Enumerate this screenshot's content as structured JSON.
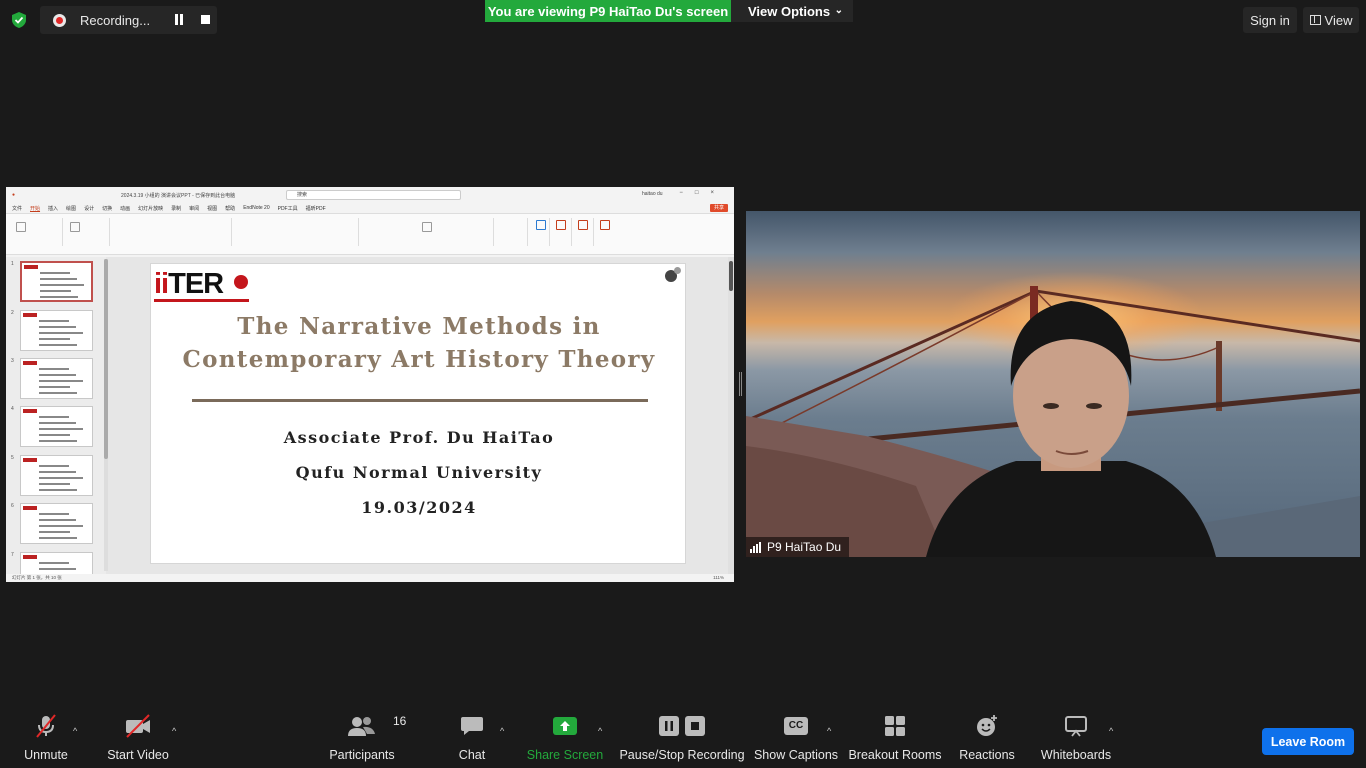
{
  "top_bar": {
    "security_icon": "shield-check-icon",
    "recording_label": "Recording...",
    "viewing_banner": "You are viewing P9 HaiTao Du's screen",
    "view_options_label": "View Options",
    "sign_in_label": "Sign in",
    "view_label": "View"
  },
  "shared_screen": {
    "ppt_title_bar": "2024.3.19 小组的 演讲会议PPT - 已保存到此台电脑",
    "search_placeholder": "搜索",
    "user_name": "haitao du",
    "menu_items": [
      "文件",
      "开始",
      "插入",
      "绘图",
      "设计",
      "切换",
      "动画",
      "幻灯片放映",
      "录制",
      "审阅",
      "视图",
      "帮助",
      "EndNote 20",
      "PDF工具",
      "福昕PDF"
    ],
    "share_button": "共享",
    "slide_numbers": [
      "1",
      "2",
      "3",
      "4",
      "5",
      "6",
      "7"
    ],
    "status_left": "幻灯片 第 1 张，共 10 张",
    "status_zoom": "111%",
    "slide": {
      "logo_text_red": "ii",
      "logo_text_black": "TER",
      "title_line1": "The Narrative Methods in",
      "title_line2": "Contemporary Art History Theory",
      "author": "Associate Prof. Du HaiTao",
      "university": "Qufu Normal University",
      "date": "19.03/2024"
    }
  },
  "video": {
    "participant_name": "P9 HaiTao Du"
  },
  "toolbar": {
    "unmute_label": "Unmute",
    "start_video_label": "Start Video",
    "participants_label": "Participants",
    "participants_count": "16",
    "chat_label": "Chat",
    "share_screen_label": "Share Screen",
    "pause_stop_label": "Pause/Stop Recording",
    "captions_label": "Show Captions",
    "captions_icon_text": "CC",
    "breakout_label": "Breakout Rooms",
    "reactions_label": "Reactions",
    "whiteboards_label": "Whiteboards",
    "leave_label": "Leave Room"
  },
  "colors": {
    "banner_green": "#23a93c",
    "share_green": "#23a93c",
    "leave_blue": "#0e71eb",
    "muted_red": "#e02828"
  }
}
